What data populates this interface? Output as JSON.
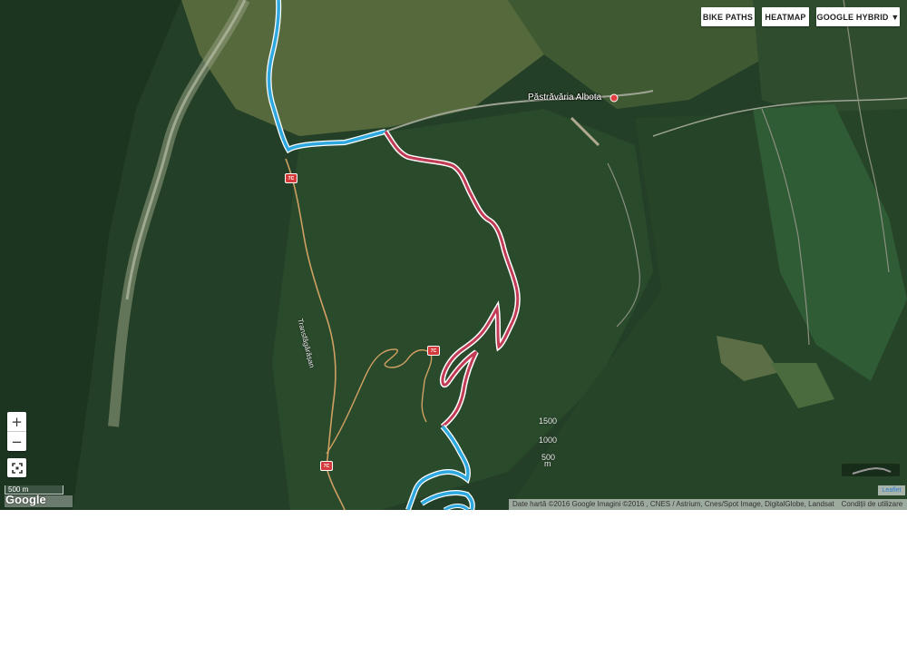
{
  "toolbar": {
    "bike_paths_label": "BIKE PATHS",
    "heatmap_label": "HEATMAP",
    "layer_label": "GOOGLE HYBRID ▼"
  },
  "map": {
    "place_labels": {
      "albota": "Păstrăvăria Albota"
    },
    "road_name": "Transfăgărășan",
    "road_shield": "7C",
    "controls": {
      "zoom_in": "+",
      "zoom_out": "−"
    },
    "scale_label": "500 m",
    "google_logo": "Google",
    "attribution": "Date hartă ©2016 Google Imagini ©2016 , CNES / Astrium, Cnes/Spot Image, DigitalGlobe, Landsat",
    "terms": "Condiții de utilizare",
    "leaflet_label": "Leaflet",
    "elevation_ticks": {
      "t1500": "1500",
      "t1000": "1000",
      "t500": "500",
      "unit": "m"
    },
    "colors": {
      "route_blue": "#2fa8e0",
      "route_red": "#c23b55",
      "road_orange": "#d0a060",
      "forest_dark": "#1f3a22"
    }
  }
}
